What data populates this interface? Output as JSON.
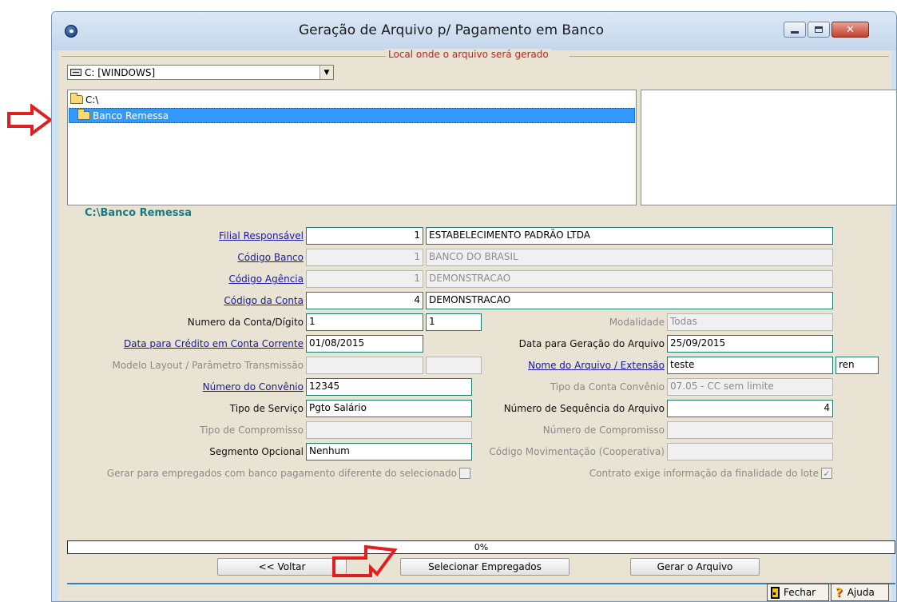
{
  "window": {
    "title": "Geração de Arquivo p/ Pagamento em Banco"
  },
  "location": {
    "group_label": "Local onde o arquivo será gerado",
    "drive": "C: [WINDOWS]",
    "dirs": [
      "C:\\",
      "Banco Remessa"
    ],
    "current_path": "C:\\Banco Remessa"
  },
  "form": {
    "filial_label": "Filial Responsável",
    "filial_code": "1",
    "filial_name": "ESTABELECIMENTO PADRÃO LTDA",
    "banco_label": "Código Banco",
    "banco_code": "1",
    "banco_name": "BANCO DO BRASIL",
    "agencia_label": "Código Agência",
    "agencia_code": "1",
    "agencia_name": "DEMONSTRACAO",
    "conta_label": "Código da Conta",
    "conta_code": "4",
    "conta_name": "DEMONSTRACAO",
    "num_conta_label": "Numero da Conta/Dígito",
    "num_conta": "1",
    "num_digito": "1",
    "modalidade_label": "Modalidade",
    "modalidade": "Todas",
    "data_credito_label": "Data para Crédito em Conta Corrente",
    "data_credito": "01/08/2015",
    "data_geracao_label": "Data para Geração do Arquivo",
    "data_geracao": "25/09/2015",
    "modelo_label": "Modelo Layout / Parâmetro Transmissão",
    "nome_arquivo_label": "Nome do Arquivo / Extensão",
    "nome_arquivo": "teste",
    "extensao": "ren",
    "convenio_label": "Número do Convênio",
    "convenio": "12345",
    "tipo_conta_convenio_label": "Tipo da Conta Convênio",
    "tipo_conta_convenio": "07.05 - CC sem limite",
    "tipo_servico_label": "Tipo de Serviço",
    "tipo_servico": "Pgto Salário",
    "num_sequencia_label": "Número de Sequência do Arquivo",
    "num_sequencia": "4",
    "tipo_compromisso_label": "Tipo de Compromisso",
    "num_compromisso_label": "Número de Compromisso",
    "segmento_label": "Segmento Opcional",
    "segmento": "Nenhum",
    "cod_mov_label": "Código Movimentação (Cooperativa)",
    "chk_empregados_label": "Gerar para empregados com banco pagamento diferente do selecionado",
    "chk_contrato_label": "Contrato exige informação da finalidade do lote"
  },
  "progress": {
    "value": 0,
    "label": "0%"
  },
  "buttons": {
    "voltar": "<< Voltar",
    "selecionar": "Selecionar Empregados",
    "gerar": "Gerar o Arquivo",
    "fechar": "Fechar",
    "ajuda": "Ajuda"
  },
  "colors": {
    "selection": "#3399ff",
    "annotation_arrow": "#e02020",
    "label_link": "#1a1aa0",
    "group_label": "#d01c1c"
  }
}
